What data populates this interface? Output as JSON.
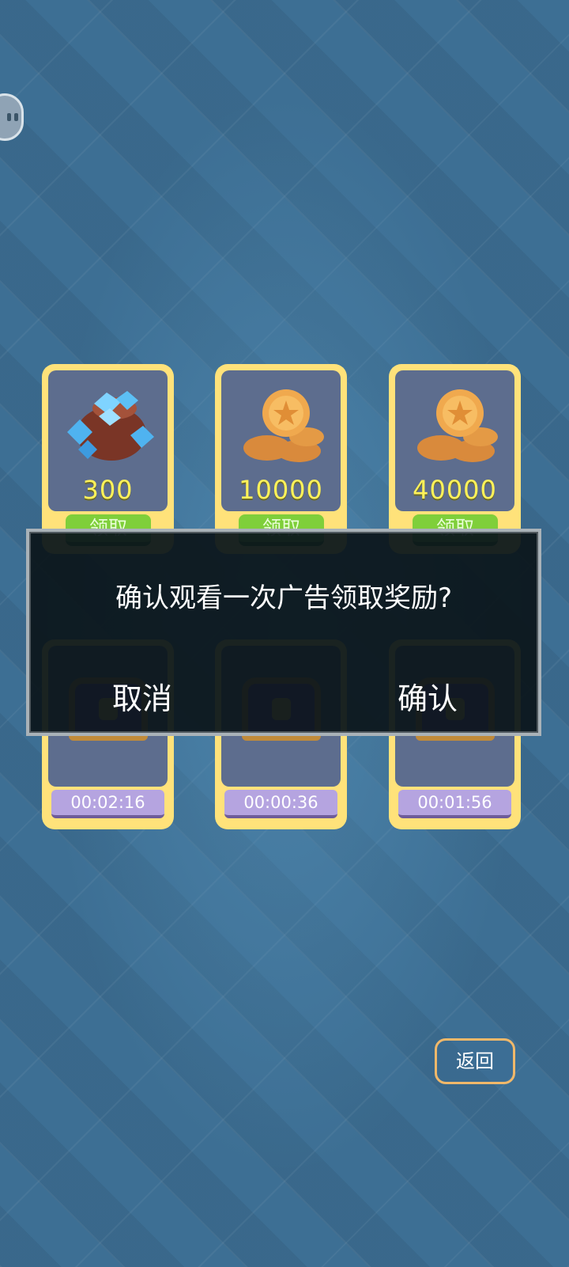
{
  "rewards": [
    {
      "icon": "gems-bag-icon",
      "amount": "300",
      "claim_label": "领取"
    },
    {
      "icon": "gold-coins-icon",
      "amount": "10000",
      "claim_label": "领取"
    },
    {
      "icon": "gold-coins-icon",
      "amount": "40000",
      "claim_label": "领取"
    }
  ],
  "chests": [
    {
      "icon": "treasure-chest-icon",
      "timer": "00:02:16"
    },
    {
      "icon": "treasure-chest-icon",
      "timer": "00:00:36"
    },
    {
      "icon": "treasure-chest-icon",
      "timer": "00:01:56"
    }
  ],
  "dialog": {
    "message": "确认观看一次广告领取奖励?",
    "cancel_label": "取消",
    "confirm_label": "确认"
  },
  "back_label": "返回",
  "colors": {
    "card_border": "#ffe27a",
    "amount_text": "#fff25a",
    "claim_button": "#7fcf3a",
    "timer_bar": "#b5a4e0",
    "dialog_bg": "#0c161c",
    "back_border": "#f0b86a"
  }
}
